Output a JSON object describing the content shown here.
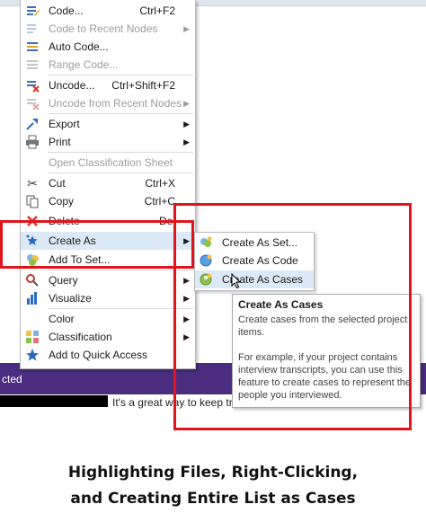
{
  "background": {
    "status_text": "cted",
    "message": "It's a great way to keep track",
    "accent": "#4a2d7f"
  },
  "menu": {
    "items": [
      {
        "name": "code",
        "label": "Code...",
        "shortcut": "Ctrl+F2",
        "submenu": false,
        "disabled": false,
        "icon": "code-icon"
      },
      {
        "name": "code-to-recent-nodes",
        "label": "Code to Recent Nodes",
        "shortcut": "",
        "submenu": true,
        "disabled": true,
        "icon": "code-recent-icon"
      },
      {
        "name": "auto-code",
        "label": "Auto Code...",
        "shortcut": "",
        "submenu": false,
        "disabled": false,
        "icon": "auto-code-icon"
      },
      {
        "name": "range-code",
        "label": "Range Code...",
        "shortcut": "",
        "submenu": false,
        "disabled": true,
        "icon": "range-code-icon"
      },
      {
        "name": "uncode",
        "label": "Uncode...",
        "shortcut": "Ctrl+Shift+F2",
        "submenu": false,
        "disabled": false,
        "icon": "uncode-icon"
      },
      {
        "name": "uncode-from-recent-nodes",
        "label": "Uncode from Recent Nodes",
        "shortcut": "",
        "submenu": true,
        "disabled": true,
        "icon": "uncode-recent-icon"
      },
      {
        "name": "export",
        "label": "Export",
        "shortcut": "",
        "submenu": true,
        "disabled": false,
        "icon": "export-icon"
      },
      {
        "name": "print",
        "label": "Print",
        "shortcut": "",
        "submenu": true,
        "disabled": false,
        "icon": "printer-icon"
      },
      {
        "name": "open-classification-sheet",
        "label": "Open Classification Sheet",
        "shortcut": "",
        "submenu": false,
        "disabled": true,
        "icon": ""
      },
      {
        "name": "cut",
        "label": "Cut",
        "shortcut": "Ctrl+X",
        "submenu": false,
        "disabled": false,
        "icon": "scissors-icon"
      },
      {
        "name": "copy",
        "label": "Copy",
        "shortcut": "Ctrl+C",
        "submenu": false,
        "disabled": false,
        "icon": "copy-icon"
      },
      {
        "name": "delete",
        "label": "Delete",
        "shortcut": "Del",
        "submenu": false,
        "disabled": false,
        "icon": "delete-icon"
      },
      {
        "name": "create-as",
        "label": "Create As",
        "shortcut": "",
        "submenu": true,
        "disabled": false,
        "icon": "create-as-icon",
        "highlighted": true
      },
      {
        "name": "add-to-set",
        "label": "Add To Set...",
        "shortcut": "",
        "submenu": false,
        "disabled": false,
        "icon": "add-to-set-icon"
      },
      {
        "name": "query",
        "label": "Query",
        "shortcut": "",
        "submenu": true,
        "disabled": false,
        "icon": "query-icon"
      },
      {
        "name": "visualize",
        "label": "Visualize",
        "shortcut": "",
        "submenu": true,
        "disabled": false,
        "icon": "chart-icon"
      },
      {
        "name": "color",
        "label": "Color",
        "shortcut": "",
        "submenu": true,
        "disabled": false,
        "icon": ""
      },
      {
        "name": "classification",
        "label": "Classification",
        "shortcut": "",
        "submenu": true,
        "disabled": false,
        "icon": "classification-icon"
      },
      {
        "name": "add-to-quick-access",
        "label": "Add to Quick Access",
        "shortcut": "",
        "submenu": false,
        "disabled": false,
        "icon": "star-icon"
      }
    ]
  },
  "submenu": {
    "items": [
      {
        "name": "create-as-set",
        "label": "Create As Set...",
        "icon": "set-icon"
      },
      {
        "name": "create-as-code",
        "label": "Create As Code",
        "icon": "node-icon"
      },
      {
        "name": "create-as-cases",
        "label": "Create As Cases",
        "icon": "cases-icon",
        "highlighted": true
      }
    ]
  },
  "tooltip": {
    "title": "Create As Cases",
    "description": "Create cases from the selected project items.",
    "example": "For example, if your project contains interview transcripts, you can use this feature to create cases to represent the people you interviewed."
  },
  "caption": {
    "line1": "Highlighting Files, Right-Clicking,",
    "line2": "and Creating Entire List as Cases"
  },
  "annotation_color": "#e0141a"
}
